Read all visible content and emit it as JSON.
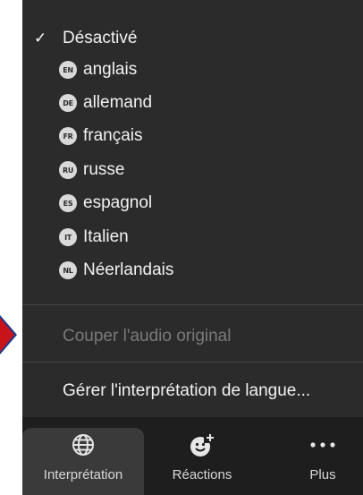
{
  "menu": {
    "off_item": {
      "label": "Désactivé",
      "checked": true
    },
    "languages": [
      {
        "code": "EN",
        "label": "anglais"
      },
      {
        "code": "DE",
        "label": "allemand"
      },
      {
        "code": "FR",
        "label": "français"
      },
      {
        "code": "RU",
        "label": "russe"
      },
      {
        "code": "ES",
        "label": "espagnol"
      },
      {
        "code": "IT",
        "label": "Italien"
      },
      {
        "code": "NL",
        "label": "Néerlandais"
      }
    ],
    "mute_original": "Couper l'audio original",
    "manage": "Gérer l'interprétation de langue..."
  },
  "toolbar": {
    "interpretation": {
      "label": "Interprétation",
      "icon": "globe-icon"
    },
    "reactions": {
      "label": "Réactions",
      "icon": "emoji-add-icon"
    },
    "more": {
      "label": "Plus",
      "icon": "ellipsis-icon"
    }
  },
  "colors": {
    "panel_bg": "#2b2b2b",
    "toolbar_bg": "#1e1e1e",
    "text": "#f2f2f2",
    "disabled_text": "#7a7a7a",
    "pointer_red": "#c8131b",
    "pointer_blue": "#1f3a8a"
  }
}
